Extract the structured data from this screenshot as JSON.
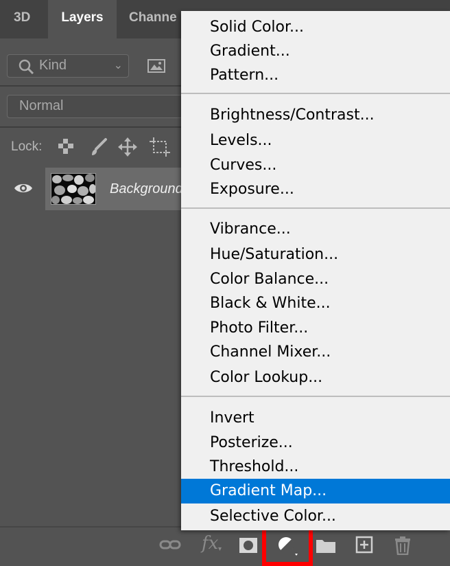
{
  "tabs": [
    {
      "label": "3D"
    },
    {
      "label": "Layers"
    },
    {
      "label": "Channe"
    }
  ],
  "filter": {
    "kind_label": "Kind"
  },
  "blend_mode": "Normal",
  "lock_label": "Lock:",
  "layer": {
    "name": "Background"
  },
  "menu": {
    "items": [
      "Solid Color...",
      "Gradient...",
      "Pattern...",
      "Brightness/Contrast...",
      "Levels...",
      "Curves...",
      "Exposure...",
      "Vibrance...",
      "Hue/Saturation...",
      "Color Balance...",
      "Black & White...",
      "Photo Filter...",
      "Channel Mixer...",
      "Color Lookup...",
      "Invert",
      "Posterize...",
      "Threshold...",
      "Gradient Map...",
      "Selective Color..."
    ],
    "selected": "Gradient Map..."
  },
  "colors": {
    "panel_bg": "#535353",
    "menu_bg": "#f0f0f0",
    "selection": "#0078d7",
    "highlight": "#ff0000"
  },
  "icons": {
    "bottom": [
      "link-icon",
      "fx-icon",
      "mask-icon",
      "adjustment-layer-icon",
      "folder-icon",
      "new-layer-icon",
      "trash-icon"
    ]
  }
}
